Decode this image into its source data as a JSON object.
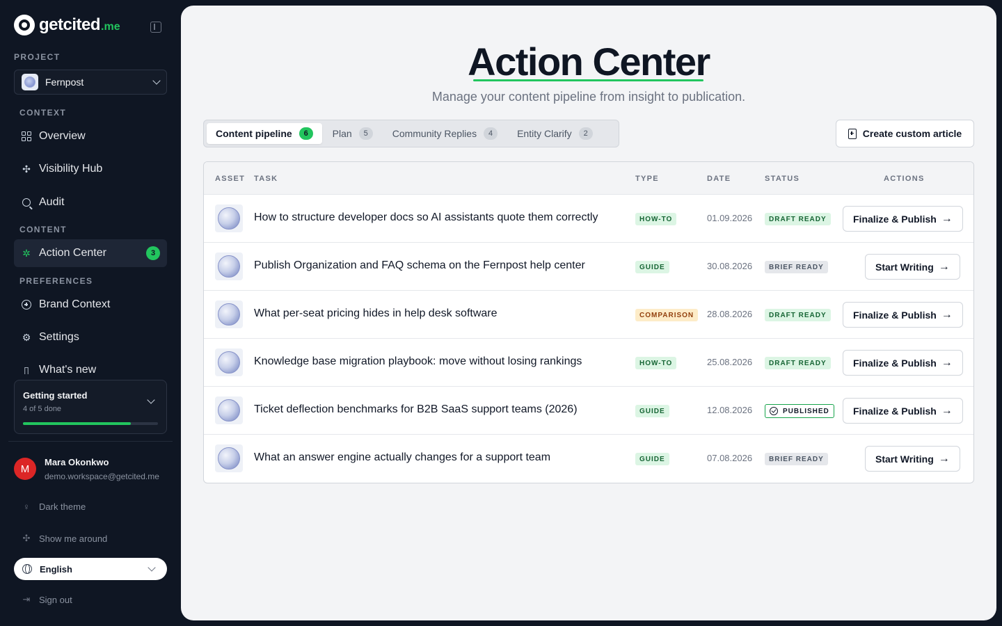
{
  "brand": {
    "name": "getcited",
    "tld": ".me"
  },
  "sidebar": {
    "project_label": "PROJECT",
    "project_name": "Fernpost",
    "context_label": "CONTEXT",
    "content_label": "CONTENT",
    "preferences_label": "PREFERENCES",
    "items": [
      {
        "label": "Overview"
      },
      {
        "label": "Visibility Hub"
      },
      {
        "label": "Audit"
      },
      {
        "label": "Action Center",
        "badge": "3"
      },
      {
        "label": "Brand Context"
      },
      {
        "label": "Settings"
      },
      {
        "label": "What's new"
      }
    ],
    "getting_started": {
      "title": "Getting started",
      "progress_text": "4 of 5 done",
      "progress": 0.8
    },
    "user": {
      "initial": "M",
      "name": "Mara Okonkwo",
      "email": "demo.workspace@getcited.me"
    },
    "dark_theme": "Dark theme",
    "show_around": "Show me around",
    "language": "English",
    "sign_out": "Sign out"
  },
  "main": {
    "title": "Action Center",
    "subtitle": "Manage your content pipeline from insight to publication.",
    "tabs": [
      {
        "label": "Content pipeline",
        "count": "6"
      },
      {
        "label": "Plan",
        "count": "5"
      },
      {
        "label": "Community Replies",
        "count": "4"
      },
      {
        "label": "Entity Clarify",
        "count": "2"
      }
    ],
    "create_button": "Create custom article",
    "table": {
      "headers": {
        "asset": "ASSET",
        "task": "TASK",
        "type": "TYPE",
        "date": "DATE",
        "status": "STATUS",
        "actions": "ACTIONS"
      },
      "rows": [
        {
          "task": "How to structure developer docs so AI assistants quote them correctly",
          "type": "HOW-TO",
          "date": "01.09.2026",
          "status": "DRAFT READY",
          "action": "Finalize & Publish"
        },
        {
          "task": "Publish Organization and FAQ schema on the Fernpost help center",
          "type": "GUIDE",
          "date": "30.08.2026",
          "status": "BRIEF READY",
          "action": "Start Writing"
        },
        {
          "task": "What per-seat pricing hides in help desk software",
          "type": "COMPARISON",
          "date": "28.08.2026",
          "status": "DRAFT READY",
          "action": "Finalize & Publish"
        },
        {
          "task": "Knowledge base migration playbook: move without losing rankings",
          "type": "HOW-TO",
          "date": "25.08.2026",
          "status": "DRAFT READY",
          "action": "Finalize & Publish"
        },
        {
          "task": "Ticket deflection benchmarks for B2B SaaS support teams (2026)",
          "type": "GUIDE",
          "date": "12.08.2026",
          "status": "PUBLISHED",
          "action": "Finalize & Publish"
        },
        {
          "task": "What an answer engine actually changes for a support team",
          "type": "GUIDE",
          "date": "07.08.2026",
          "status": "BRIEF READY",
          "action": "Start Writing"
        }
      ]
    }
  }
}
